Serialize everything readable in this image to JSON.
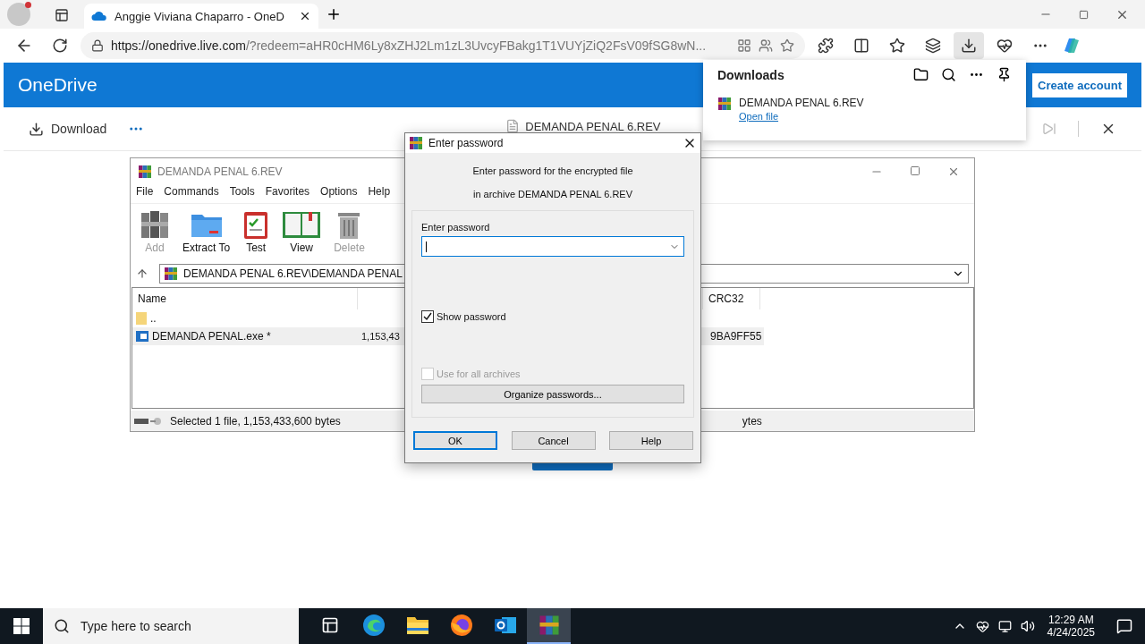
{
  "browser": {
    "tab_title": "Anggie Viviana Chaparro - OneD",
    "url_host": "https://onedrive.live.com",
    "url_path": "/?redeem=aHR0cHM6Ly8xZHJ2Lm1zL3UvcyFBakg1T1VUYjZiQ2FsV09fSG8wN..."
  },
  "onedrive": {
    "brand": "OneDrive",
    "create_account": "Create account",
    "download": "Download",
    "file_name": "DEMANDA PENAL 6.REV"
  },
  "downloads": {
    "title": "Downloads",
    "items": [
      {
        "name": "DEMANDA PENAL 6.REV",
        "action": "Open file"
      }
    ]
  },
  "winrar": {
    "title": "DEMANDA PENAL 6.REV",
    "menu": [
      "File",
      "Commands",
      "Tools",
      "Favorites",
      "Options",
      "Help"
    ],
    "toolbar": [
      {
        "kind": "add",
        "label": "Add",
        "disabled": true
      },
      {
        "kind": "extract",
        "label": "Extract To",
        "disabled": false
      },
      {
        "kind": "test",
        "label": "Test",
        "disabled": false
      },
      {
        "kind": "view",
        "label": "View",
        "disabled": false
      },
      {
        "kind": "delete",
        "label": "Delete",
        "disabled": true
      }
    ],
    "path": "DEMANDA PENAL 6.REV\\DEMANDA PENAL",
    "columns": [
      "Name",
      "CRC32"
    ],
    "rows": [
      {
        "kind": "folder",
        "name": "..",
        "selected": false
      },
      {
        "kind": "file",
        "name": "DEMANDA PENAL.exe *",
        "size": "1,153,43",
        "crc32": "9BA9FF55",
        "selected": true
      }
    ],
    "status_left": "Selected 1 file, 1,153,433,600 bytes",
    "status_right": "ytes"
  },
  "dialog": {
    "title": "Enter password",
    "message": [
      "Enter password for the encrypted file",
      "in archive DEMANDA PENAL 6.REV"
    ],
    "field_label": "Enter password",
    "checkboxes": [
      {
        "label": "Show password",
        "checked": true,
        "disabled": false
      },
      {
        "label": "Use for all archives",
        "checked": false,
        "disabled": true
      }
    ],
    "organize": "Organize passwords...",
    "buttons": [
      {
        "label": "OK",
        "focused": true
      },
      {
        "label": "Cancel",
        "focused": false
      },
      {
        "label": "Help",
        "focused": false
      }
    ]
  },
  "taskbar": {
    "search_placeholder": "Type here to search",
    "apps": [
      {
        "kind": "taskview",
        "selected": false
      },
      {
        "kind": "edge",
        "selected": false
      },
      {
        "kind": "explorer",
        "selected": false
      },
      {
        "kind": "firefox",
        "selected": false
      },
      {
        "kind": "outlook",
        "selected": false
      },
      {
        "kind": "winrar",
        "selected": true
      }
    ],
    "time": "12:29 AM",
    "date": "4/24/2025"
  }
}
